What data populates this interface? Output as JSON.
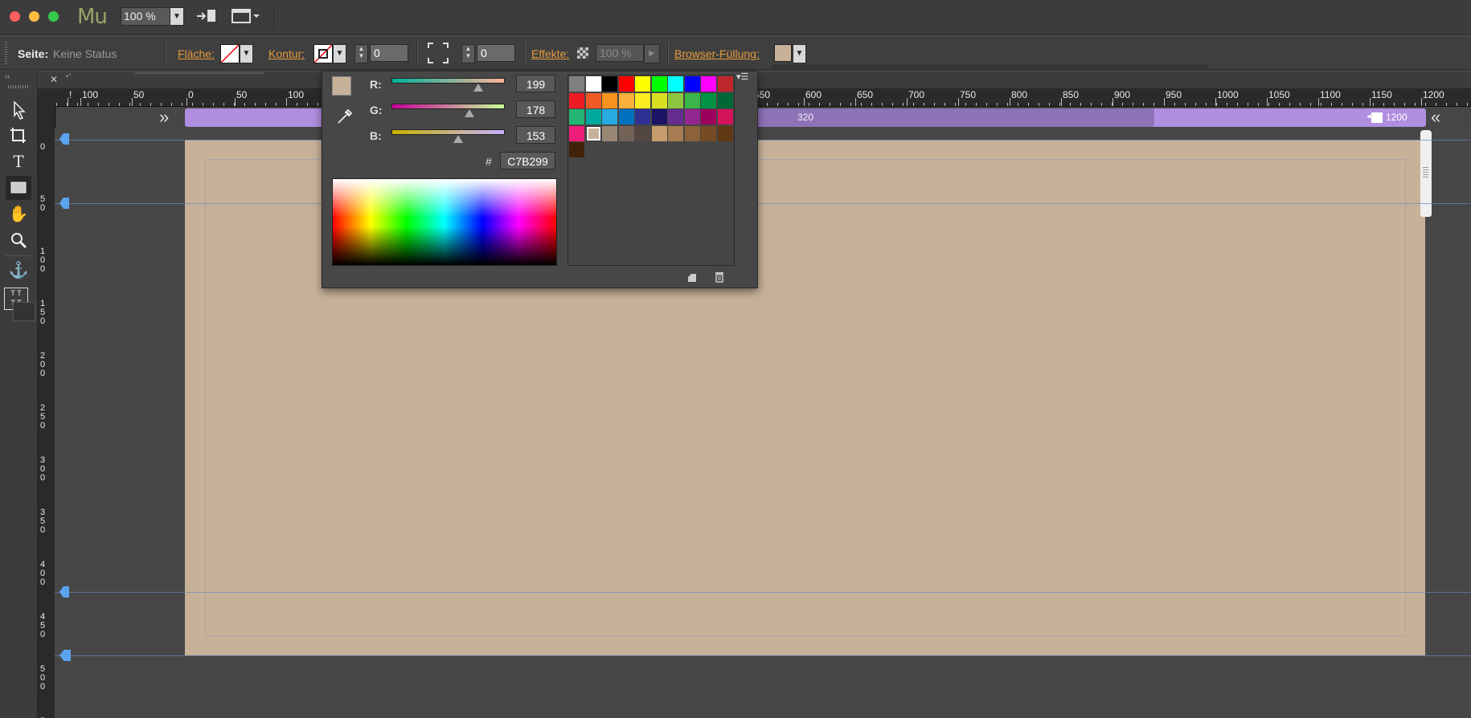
{
  "app": {
    "logo": "Mu",
    "zoom": "100 %"
  },
  "toolbar": {
    "page_label": "Seite:",
    "page_status": "Keine Status",
    "fill_label": "Fläche:",
    "stroke_label": "Kontur:",
    "stroke_width": "0",
    "corner_radius": "0",
    "effects_label": "Effekte:",
    "opacity": "100 %",
    "browser_fill_label": "Browser-Füllung:"
  },
  "ruler": {
    "h_labels": [
      "!",
      "100",
      "50",
      "0",
      "50",
      "100",
      "550",
      "600",
      "650",
      "700",
      "750",
      "800",
      "850",
      "900",
      "950",
      "1000",
      "1050",
      "1100",
      "1150",
      "1200"
    ],
    "v_labels": [
      "0",
      "50",
      "100",
      "150",
      "200",
      "250",
      "300",
      "350",
      "400",
      "450",
      "500",
      "5"
    ]
  },
  "breakpoints": {
    "mid": "320",
    "right": "1200"
  },
  "color_picker": {
    "r_label": "R:",
    "g_label": "G:",
    "b_label": "B:",
    "r": "199",
    "g": "178",
    "b": "153",
    "hash": "#",
    "hex": "C7B299",
    "r_level": 0.78,
    "g_level": 0.7,
    "b_level": 0.6,
    "current_color": "#c7b299"
  },
  "swatches": [
    [
      "#7f7f7f",
      "#ffffff",
      "#000000",
      "#ff0000",
      "#ffff00",
      "#00ff00",
      "#00ffff",
      "#0000ff",
      "#ff00ff",
      "#c0272d"
    ],
    [
      "#ed1c24",
      "#f15a24",
      "#f7931e",
      "#fbb03b",
      "#fcee21",
      "#d9e021",
      "#8cc63f",
      "#39b54a",
      "#009245",
      "#006837"
    ],
    [
      "#22b573",
      "#00a99d",
      "#29abe2",
      "#0071bc",
      "#2e3192",
      "#1b1464",
      "#662d91",
      "#93278f",
      "#9e005d",
      "#d4145a"
    ],
    [
      "#ed1e79",
      "#c7b299",
      "#998675",
      "#736357",
      "#534741",
      "#c69c6d",
      "#a67c52",
      "#8c6239",
      "#754c24",
      "#603813"
    ],
    [
      "#42210b"
    ]
  ],
  "colors": {
    "page_fill": "#c7b299",
    "accent_orange": "#e59b3d",
    "breakpoint_purple": "#b08ee0"
  }
}
